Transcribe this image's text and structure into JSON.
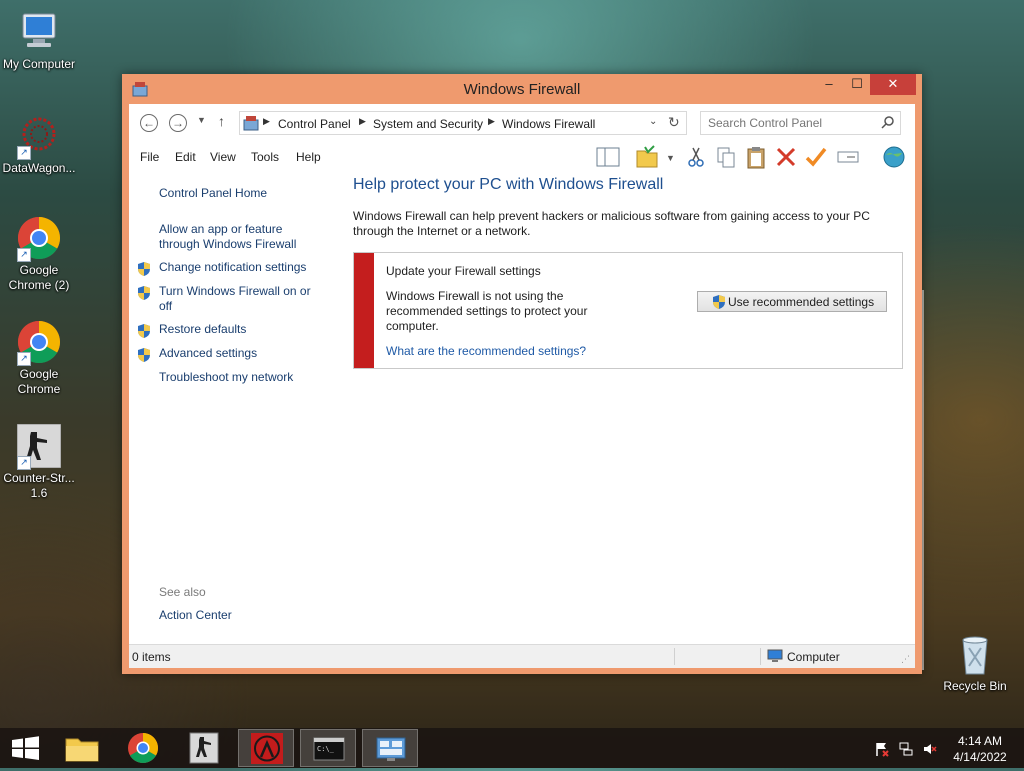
{
  "desktop": {
    "icons": [
      {
        "label": "My Computer",
        "icon": "computer-icon"
      },
      {
        "label": "DataWagon...",
        "icon": "datawagon-icon"
      },
      {
        "label": "Google Chrome (2)",
        "icon": "chrome-icon"
      },
      {
        "label": "Google Chrome",
        "icon": "chrome-icon"
      },
      {
        "label": "Counter-Str... 1.6",
        "icon": "counter-strike-icon"
      },
      {
        "label": "Recycle Bin",
        "icon": "recycle-bin-icon"
      }
    ]
  },
  "window": {
    "title": "Windows Firewall",
    "controls": {
      "minimize": "–",
      "maximize": "☐",
      "close": "✕"
    },
    "accent_color": "#ef9a6e"
  },
  "address": {
    "crumbs": [
      "Control Panel",
      "System and Security",
      "Windows Firewall"
    ],
    "search_placeholder": "Search Control Panel"
  },
  "menu": [
    "File",
    "Edit",
    "View",
    "Tools",
    "Help"
  ],
  "left_pane": {
    "home": "Control Panel Home",
    "links": [
      "Allow an app or feature through Windows Firewall",
      "Change notification settings",
      "Turn Windows Firewall on or off",
      "Restore defaults",
      "Advanced settings",
      "Troubleshoot my network"
    ],
    "see_also_label": "See also",
    "see_also_links": [
      "Action Center"
    ]
  },
  "content": {
    "heading": "Help protect your PC with Windows Firewall",
    "description": "Windows Firewall can help prevent hackers or malicious software from gaining access to your PC through the Internet or a network.",
    "panel": {
      "title": "Update your Firewall settings",
      "message": "Windows Firewall is not using the recommended settings to protect your computer.",
      "button": "Use recommended settings",
      "link": "What are the recommended settings?",
      "alert_color": "#c41e1e"
    }
  },
  "status": {
    "items": "0 items",
    "location": "Computer"
  },
  "taskbar": {
    "time": "4:14 AM",
    "date": "4/14/2022"
  }
}
